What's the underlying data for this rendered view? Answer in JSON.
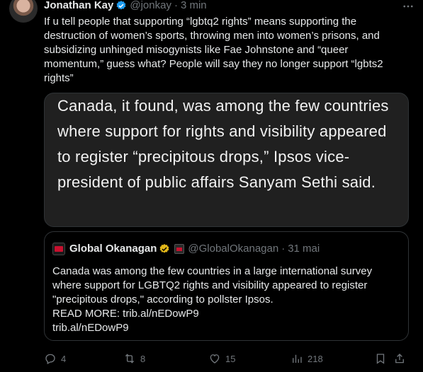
{
  "tweet": {
    "author_name": "Jonathan Kay",
    "handle": "@jonkay",
    "separator": "·",
    "time": "3 min",
    "text": "If u tell people that supporting “lgbtq2 rights” means supporting the destruction of women’s sports, throwing men into women’s prisons, and subsidizing unhinged misogynists like Fae Johnstone and “queer momentum,” guess what? People will say they no longer support “lgbts2 rights”"
  },
  "image_card": {
    "text": "Canada, it found, was among the few countries where support for rights and visibility appeared to register “precipitous drops,” Ipsos vice-president of public affairs Sanyam Sethi said."
  },
  "quote": {
    "author_name": "Global Okanagan",
    "handle": "@GlobalOkanagan",
    "separator": "·",
    "time": "31 mai",
    "lines": [
      "Canada was among the few countries in a large international survey",
      "where support for LGBTQ2 rights and visibility appeared to register",
      "\"precipitous drops,\" according to pollster Ipsos.",
      "READ MORE: trib.al/nEDowP9",
      "trib.al/nEDowP9"
    ]
  },
  "actions": {
    "replies": "4",
    "reposts": "8",
    "likes": "15",
    "views": "218"
  },
  "colors": {
    "background": "#000000",
    "text": "#e7e9ea",
    "muted": "#71767b",
    "verified_blue": "#1d9bf0",
    "verified_gold": "#e2b719",
    "border": "#2f3336"
  },
  "icons": [
    "more-icon",
    "verified-badge-icon",
    "gold-verified-badge-icon",
    "reply-icon",
    "repost-icon",
    "like-icon",
    "views-icon",
    "bookmark-icon",
    "share-icon"
  ]
}
